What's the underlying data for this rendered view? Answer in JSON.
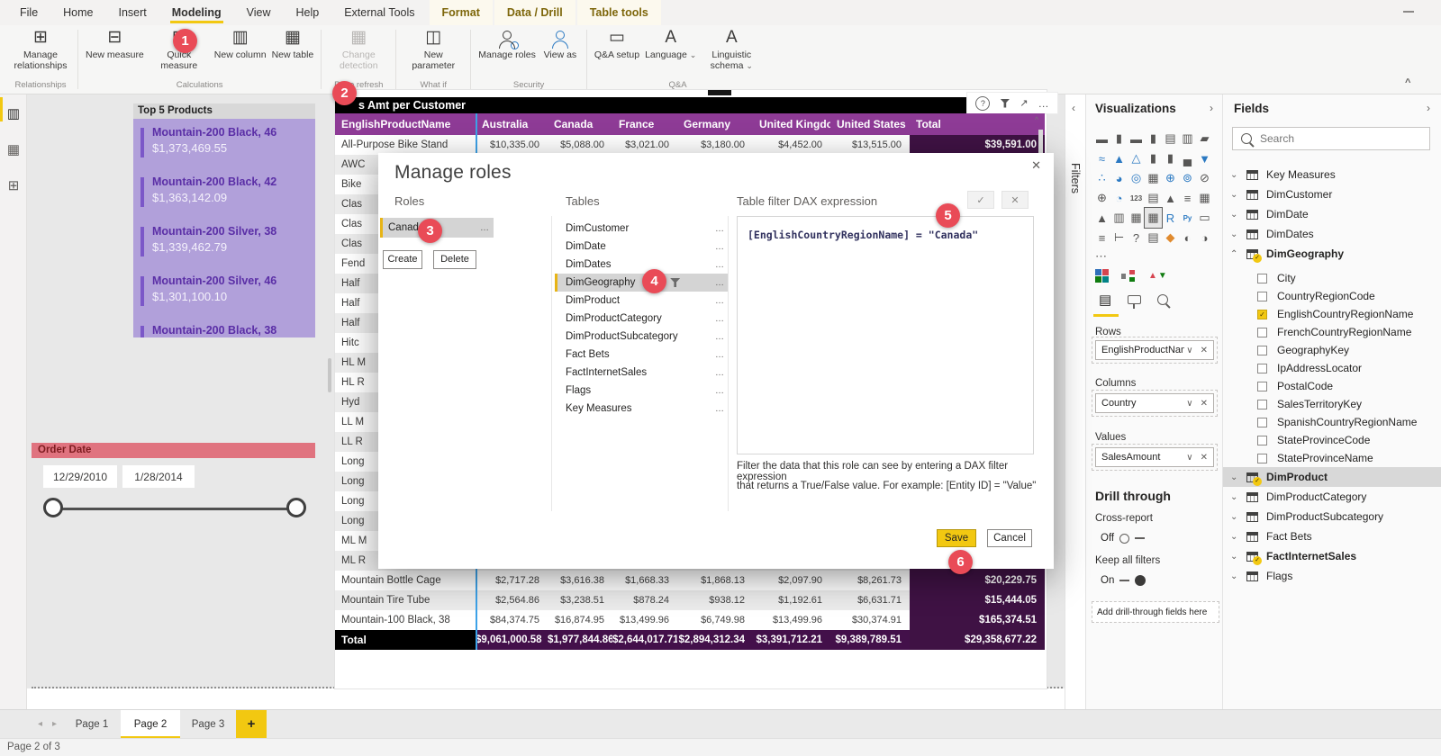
{
  "icons": {
    "chevron_down": "⌄",
    "chevron_up": "⌃",
    "chevron_left": "‹",
    "chevron_right": "›",
    "close": "✕",
    "more": "…",
    "ellipsis": "⋯",
    "check": "✓",
    "help": "?",
    "plus": "+",
    "caret_up": "^",
    "left_arrow": "◂",
    "right_arrow": "▸",
    "expand": "↗",
    "dropdown": "∨"
  },
  "colors": {
    "accent_yellow": "#f2c811",
    "header_purple": "#8e3b96",
    "total_purple": "#3f1244",
    "badge_red": "#e94b57",
    "lavender": "#b1a0da",
    "slicer_red": "#e0737f"
  },
  "ribbon": {
    "tabs": [
      {
        "label": "File",
        "active": false,
        "contextual": false
      },
      {
        "label": "Home",
        "active": false,
        "contextual": false
      },
      {
        "label": "Insert",
        "active": false,
        "contextual": false
      },
      {
        "label": "Modeling",
        "active": true,
        "contextual": false
      },
      {
        "label": "View",
        "active": false,
        "contextual": false
      },
      {
        "label": "Help",
        "active": false,
        "contextual": false
      },
      {
        "label": "External Tools",
        "active": false,
        "contextual": false
      },
      {
        "label": "Format",
        "active": false,
        "contextual": true
      },
      {
        "label": "Data / Drill",
        "active": false,
        "contextual": true
      },
      {
        "label": "Table tools",
        "active": false,
        "contextual": true
      }
    ],
    "groups": [
      {
        "label": "Relationships",
        "buttons": [
          {
            "label": "Manage relationships",
            "ic": "⊞"
          }
        ]
      },
      {
        "label": "Calculations",
        "buttons": [
          {
            "label": "New measure",
            "ic": "⊟"
          },
          {
            "label": "Quick measure",
            "ic": "⊟",
            "bd": "ϟ"
          },
          {
            "label": "New column",
            "ic": "▥"
          },
          {
            "label": "New table",
            "ic": "▦"
          }
        ]
      },
      {
        "label": "Page refresh",
        "buttons": [
          {
            "label": "Change detection",
            "ic": "▦",
            "disabled": true
          }
        ]
      },
      {
        "label": "What if",
        "buttons": [
          {
            "label": "New parameter",
            "ic": "◫"
          }
        ]
      },
      {
        "label": "Security",
        "buttons": [
          {
            "label": "Manage roles",
            "person": true,
            "dot": true
          },
          {
            "label": "View as",
            "person": true,
            "blue": true
          }
        ]
      },
      {
        "label": "Q&A",
        "buttons": [
          {
            "label": "Q&A setup",
            "ic": "▭"
          },
          {
            "label": "Language",
            "ic": "A",
            "dd": true
          },
          {
            "label": "Linguistic schema",
            "ic": "A",
            "dd": true
          }
        ]
      }
    ]
  },
  "view_strip": {
    "items": [
      {
        "name": "report-view",
        "ic": "▥",
        "active": true
      },
      {
        "name": "data-view",
        "ic": "▦",
        "active": false
      },
      {
        "name": "model-view",
        "ic": "⊞",
        "active": false
      }
    ]
  },
  "badges": [
    "1",
    "2",
    "3",
    "4",
    "5",
    "6"
  ],
  "canvas": {
    "top5": {
      "title": "Top 5 Products",
      "items": [
        {
          "name": "Mountain-200 Black, 46",
          "value": "$1,373,469.55"
        },
        {
          "name": "Mountain-200 Black, 42",
          "value": "$1,363,142.09"
        },
        {
          "name": "Mountain-200 Silver, 38",
          "value": "$1,339,462.79"
        },
        {
          "name": "Mountain-200 Silver, 46",
          "value": "$1,301,100.10"
        },
        {
          "name": "Mountain-200 Black, 38",
          "value": ""
        }
      ]
    },
    "order_date": {
      "title": "Order Date",
      "start": "12/29/2010",
      "end": "1/28/2014"
    },
    "matrix": {
      "title": "s Amt per Customer",
      "columns": [
        "EnglishProductName",
        "Australia",
        "Canada",
        "France",
        "Germany",
        "United Kingdom",
        "United States",
        "Total"
      ],
      "rows": [
        {
          "name": "All-Purpose Bike Stand",
          "values": [
            "$10,335.00",
            "$5,088.00",
            "$3,021.00",
            "$3,180.00",
            "$4,452.00",
            "$13,515.00"
          ],
          "total": "$39,591.00"
        },
        {
          "name": "AWC",
          "values": [
            "",
            "",
            "",
            "",
            "",
            ""
          ],
          "total": ""
        },
        {
          "name": "Bike",
          "values": [
            "",
            "",
            "",
            "",
            "",
            ""
          ],
          "total": ""
        },
        {
          "name": "Clas",
          "values": [
            "",
            "",
            "",
            "",
            "",
            ""
          ],
          "total": ""
        },
        {
          "name": "Clas",
          "values": [
            "",
            "",
            "",
            "",
            "",
            ""
          ],
          "total": ""
        },
        {
          "name": "Clas",
          "values": [
            "",
            "",
            "",
            "",
            "",
            ""
          ],
          "total": ""
        },
        {
          "name": "Fend",
          "values": [
            "",
            "",
            "",
            "",
            "",
            ""
          ],
          "total": ""
        },
        {
          "name": "Half",
          "values": [
            "",
            "",
            "",
            "",
            "",
            ""
          ],
          "total": ""
        },
        {
          "name": "Half",
          "values": [
            "",
            "",
            "",
            "",
            "",
            ""
          ],
          "total": ""
        },
        {
          "name": "Half",
          "values": [
            "",
            "",
            "",
            "",
            "",
            ""
          ],
          "total": ""
        },
        {
          "name": "Hitc",
          "values": [
            "",
            "",
            "",
            "",
            "",
            ""
          ],
          "total": ""
        },
        {
          "name": "HL M",
          "values": [
            "",
            "",
            "",
            "",
            "",
            ""
          ],
          "total": ""
        },
        {
          "name": "HL R",
          "values": [
            "",
            "",
            "",
            "",
            "",
            ""
          ],
          "total": ""
        },
        {
          "name": "Hyd",
          "values": [
            "",
            "",
            "",
            "",
            "",
            ""
          ],
          "total": ""
        },
        {
          "name": "LL M",
          "values": [
            "",
            "",
            "",
            "",
            "",
            ""
          ],
          "total": ""
        },
        {
          "name": "LL R",
          "values": [
            "",
            "",
            "",
            "",
            "",
            ""
          ],
          "total": ""
        },
        {
          "name": "Long",
          "values": [
            "",
            "",
            "",
            "",
            "",
            ""
          ],
          "total": ""
        },
        {
          "name": "Long",
          "values": [
            "",
            "",
            "",
            "",
            "",
            ""
          ],
          "total": ""
        },
        {
          "name": "Long",
          "values": [
            "",
            "",
            "",
            "",
            "",
            ""
          ],
          "total": ""
        },
        {
          "name": "Long",
          "values": [
            "",
            "",
            "",
            "",
            "",
            ""
          ],
          "total": ""
        },
        {
          "name": "ML M",
          "values": [
            "",
            "",
            "",
            "",
            "",
            ""
          ],
          "total": ""
        },
        {
          "name": "ML R",
          "values": [
            "",
            "",
            "",
            "",
            "",
            ""
          ],
          "total": ""
        },
        {
          "name": "Mountain Bottle Cage",
          "values": [
            "$2,717.28",
            "$3,616.38",
            "$1,668.33",
            "$1,868.13",
            "$2,097.90",
            "$8,261.73"
          ],
          "total": "$20,229.75"
        },
        {
          "name": "Mountain Tire Tube",
          "values": [
            "$2,564.86",
            "$3,238.51",
            "$878.24",
            "$938.12",
            "$1,192.61",
            "$6,631.71"
          ],
          "total": "$15,444.05"
        },
        {
          "name": "Mountain-100 Black, 38",
          "values": [
            "$84,374.75",
            "$16,874.95",
            "$13,499.96",
            "$6,749.98",
            "$13,499.96",
            "$30,374.91"
          ],
          "total": "$165,374.51"
        }
      ],
      "total_row": {
        "name": "Total",
        "values": [
          "$9,061,000.58",
          "$1,977,844.86",
          "$2,644,017.71",
          "$2,894,312.34",
          "$3,391,712.21",
          "$9,389,789.51"
        ],
        "total": "$29,358,677.22"
      }
    }
  },
  "dialog": {
    "title": "Manage roles",
    "roles": {
      "label": "Roles",
      "items": [
        "Canada"
      ],
      "create": "Create",
      "delete": "Delete"
    },
    "tables": {
      "label": "Tables",
      "selected": "DimGeography",
      "items": [
        "DimCustomer",
        "DimDate",
        "DimDates",
        "DimGeography",
        "DimProduct",
        "DimProductCategory",
        "DimProductSubcategory",
        "Fact Bets",
        "FactInternetSales",
        "Flags",
        "Key Measures"
      ]
    },
    "dax": {
      "label": "Table filter DAX expression",
      "expression": "[EnglishCountryRegionName] = \"Canada\"",
      "helper1": "Filter the data that this role can see by entering a DAX filter expression",
      "helper2": "that returns a True/False value. For example: [Entity ID] = \"Value\"",
      "save": "Save",
      "cancel": "Cancel"
    }
  },
  "filters_strip": {
    "label": "Filters"
  },
  "visualizations": {
    "title": "Visualizations",
    "gallery": [
      {
        "n": "stacked-bar-chart-icon",
        "c": "▬"
      },
      {
        "n": "stacked-column-chart-icon",
        "c": "▮"
      },
      {
        "n": "clustered-bar-chart-icon",
        "c": "▬"
      },
      {
        "n": "clustered-column-chart-icon",
        "c": "▮"
      },
      {
        "n": "100-stacked-bar-chart-icon",
        "c": "▤"
      },
      {
        "n": "100-stacked-column-chart-icon",
        "c": "▥"
      },
      {
        "n": "ribbon-chart-icon",
        "c": "▰"
      },
      {
        "n": "line-chart-icon",
        "c": "≈",
        "cls": "blue"
      },
      {
        "n": "area-chart-icon",
        "c": "▲",
        "cls": "blue"
      },
      {
        "n": "stacked-area-chart-icon",
        "c": "△",
        "cls": "blue"
      },
      {
        "n": "line-and-stacked-column-chart-icon",
        "c": "▮"
      },
      {
        "n": "line-and-clustered-column-chart-icon",
        "c": "▮"
      },
      {
        "n": "waterfall-chart-icon",
        "c": "▄"
      },
      {
        "n": "funnel-chart-icon",
        "c": "▼",
        "cls": "blue"
      },
      {
        "n": "scatter-chart-icon",
        "c": "∴",
        "cls": "blue"
      },
      {
        "n": "pie-chart-icon",
        "c": "◕",
        "cls": "blue"
      },
      {
        "n": "donut-chart-icon",
        "c": "◎",
        "cls": "blue"
      },
      {
        "n": "treemap-icon",
        "c": "▦"
      },
      {
        "n": "map-icon",
        "c": "⊕",
        "cls": "blue"
      },
      {
        "n": "filled-map-icon",
        "c": "⊚",
        "cls": "blue"
      },
      {
        "n": "shape-map-icon",
        "c": "⊘"
      },
      {
        "n": "azure-map-icon",
        "c": "⊕"
      },
      {
        "n": "gauge-icon",
        "c": "◔",
        "cls": "blue"
      },
      {
        "n": "card-icon",
        "c": "123",
        "small": true
      },
      {
        "n": "multi-row-card-icon",
        "c": "▤"
      },
      {
        "n": "kpi-icon",
        "c": "▲"
      },
      {
        "n": "slicer-icon",
        "c": "≡"
      },
      {
        "n": "table-icon",
        "c": "▦"
      },
      {
        "n": "kpi-indicator-icon",
        "c": "▲"
      },
      {
        "n": "paginated-report-icon",
        "c": "▥"
      },
      {
        "n": "grid-table-icon",
        "c": "▦"
      },
      {
        "n": "matrix-icon",
        "c": "▦",
        "sel": true
      },
      {
        "n": "r-script-icon",
        "c": "R",
        "cls": "blue"
      },
      {
        "n": "python-visual-icon",
        "c": "Py",
        "cls": "blue",
        "small": true
      },
      {
        "n": "power-apps-icon",
        "c": "▭"
      },
      {
        "n": "slicer-dropdown-icon",
        "c": "≡"
      },
      {
        "n": "decomposition-tree-icon",
        "c": "⊢"
      },
      {
        "n": "qna-icon",
        "c": "?"
      },
      {
        "n": "smart-narrative-icon",
        "c": "▤"
      },
      {
        "n": "arcgis-map-icon",
        "c": "◆",
        "cls": "orange"
      },
      {
        "n": "metrics-icon",
        "c": "◐"
      },
      {
        "n": "key-influencers-icon",
        "c": "◑"
      }
    ],
    "wells": {
      "rows_label": "Rows",
      "rows_value": "EnglishProductName",
      "columns_label": "Columns",
      "columns_value": "Country",
      "values_label": "Values",
      "values_value": "SalesAmount"
    },
    "drill": {
      "title": "Drill through",
      "cross_report": "Cross-report",
      "off_label": "Off",
      "keep_label": "Keep all filters",
      "on_label": "On",
      "add_label": "Add drill-through fields here"
    }
  },
  "fields": {
    "title": "Fields",
    "search_placeholder": "Search",
    "tables": [
      {
        "name": "Key Measures"
      },
      {
        "name": "DimCustomer"
      },
      {
        "name": "DimDate"
      },
      {
        "name": "DimDates"
      },
      {
        "name": "DimGeography",
        "expanded": true,
        "checked": true,
        "bold": true,
        "children": [
          {
            "name": "City"
          },
          {
            "name": "CountryRegionCode"
          },
          {
            "name": "EnglishCountryRegionName",
            "checked": true
          },
          {
            "name": "FrenchCountryRegionName"
          },
          {
            "name": "GeographyKey"
          },
          {
            "name": "IpAddressLocator"
          },
          {
            "name": "PostalCode"
          },
          {
            "name": "SalesTerritoryKey"
          },
          {
            "name": "SpanishCountryRegionName"
          },
          {
            "name": "StateProvinceCode"
          },
          {
            "name": "StateProvinceName"
          }
        ]
      },
      {
        "name": "DimProduct",
        "selected": true,
        "checked": true,
        "bold": true
      },
      {
        "name": "DimProductCategory"
      },
      {
        "name": "DimProductSubcategory"
      },
      {
        "name": "Fact Bets"
      },
      {
        "name": "FactInternetSales",
        "checked": true,
        "bold": true
      },
      {
        "name": "Flags"
      }
    ]
  },
  "footer": {
    "pages": [
      "Page 1",
      "Page 2",
      "Page 3"
    ],
    "active": "Page 2",
    "status": "Page 2 of 3"
  }
}
